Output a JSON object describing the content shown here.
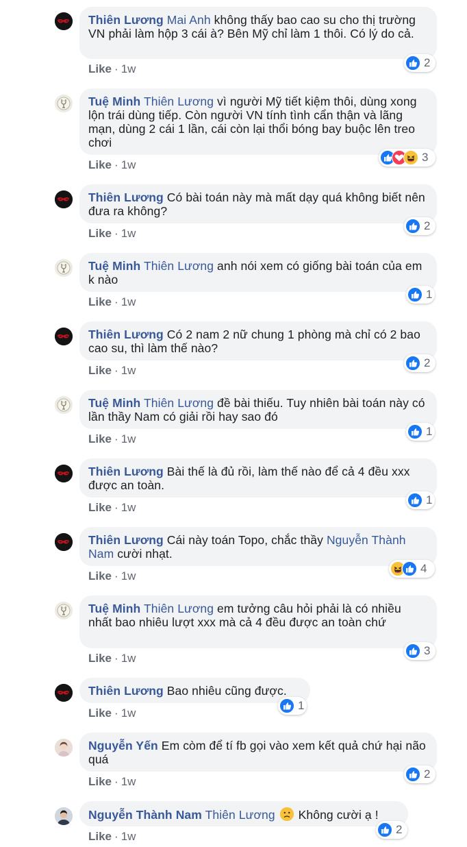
{
  "comments": [
    {
      "author": "Thiên Lương",
      "mention": "Mai Anh",
      "text": " không thấy bao cao su cho thị trường VN phải làm hộp 3 cái à? Bên Mỹ chỉ làm 1 thôi. Có lý do cả.",
      "like_label": "Like",
      "time": "1w",
      "reaction_count": "2"
    },
    {
      "author": "Tuệ Minh",
      "mention": "Thiên Lương",
      "text": " vì người Mỹ tiết kiệm thôi, dùng xong lộn trái dùng tiếp. Còn người VN tính tình cẩn thận và lãng mạn, dùng 2 cái 1 lần, cái còn lại thổi bóng bay buộc lên treo chơi",
      "like_label": "Like",
      "time": "1w",
      "reaction_count": "3"
    },
    {
      "author": "Thiên Lương",
      "mention": "",
      "text": "Có bài toán này mà mất dạy quá không biết nên đưa ra không?",
      "like_label": "Like",
      "time": "1w",
      "reaction_count": "2"
    },
    {
      "author": "Tuệ Minh",
      "mention": "Thiên Lương",
      "text": " anh nói xem có giống bài toán của em k nào",
      "like_label": "Like",
      "time": "1w",
      "reaction_count": "1"
    },
    {
      "author": "Thiên Lương",
      "mention": "",
      "text": "Có 2 nam 2 nữ chung 1 phòng mà chỉ có 2 bao cao su, thì làm thế nào?",
      "like_label": "Like",
      "time": "1w",
      "reaction_count": "2"
    },
    {
      "author": "Tuệ Minh",
      "mention": "Thiên Lương",
      "text": " đề bài thiếu. Tuy nhiên bài toán này có lần thầy Nam có giải rồi hay sao đó",
      "like_label": "Like",
      "time": "1w",
      "reaction_count": "1"
    },
    {
      "author": "Thiên Lương",
      "mention": "",
      "text": "Bài thế là đủ rồi, làm thế nào để cả 4 đều xxx được an toàn.",
      "like_label": "Like",
      "time": "1w",
      "reaction_count": "1"
    },
    {
      "author": "Thiên Lương",
      "mention": "",
      "text": "Cái này toán Topo, chắc thầy ",
      "mention2": "Nguyễn Thành Nam",
      "text2": " cười nhạt.",
      "like_label": "Like",
      "time": "1w",
      "reaction_count": "4"
    },
    {
      "author": "Tuệ Minh",
      "mention": "Thiên Lương",
      "text": " em tưởng câu hỏi phải là có nhiều nhất bao nhiêu lượt xxx mà cả 4 đều được an toàn chứ",
      "like_label": "Like",
      "time": "1w",
      "reaction_count": "3"
    },
    {
      "author": "Thiên Lương",
      "mention": "",
      "text": "Bao nhiêu cũng được.",
      "like_label": "Like",
      "time": "1w",
      "reaction_count": "1"
    },
    {
      "author": "Nguyễn Yến",
      "mention": "",
      "text": "Em còm để tí fb gọi vào xem kết quả chứ hại não quá",
      "like_label": "Like",
      "time": "1w",
      "reaction_count": "2"
    },
    {
      "author": "Nguyễn Thành Nam",
      "mention": "Thiên Lương",
      "text": "Không cười ạ !",
      "like_label": "Like",
      "time": "1w",
      "reaction_count": "2"
    }
  ],
  "icons": {
    "like": "like-reaction-icon",
    "love": "love-reaction-icon",
    "haha": "haha-reaction-icon",
    "confused": "confused-emoji-icon"
  },
  "colors": {
    "name": "#385898",
    "bubble": "#f2f3f5",
    "meta": "#606770",
    "like": "#1877f2"
  }
}
